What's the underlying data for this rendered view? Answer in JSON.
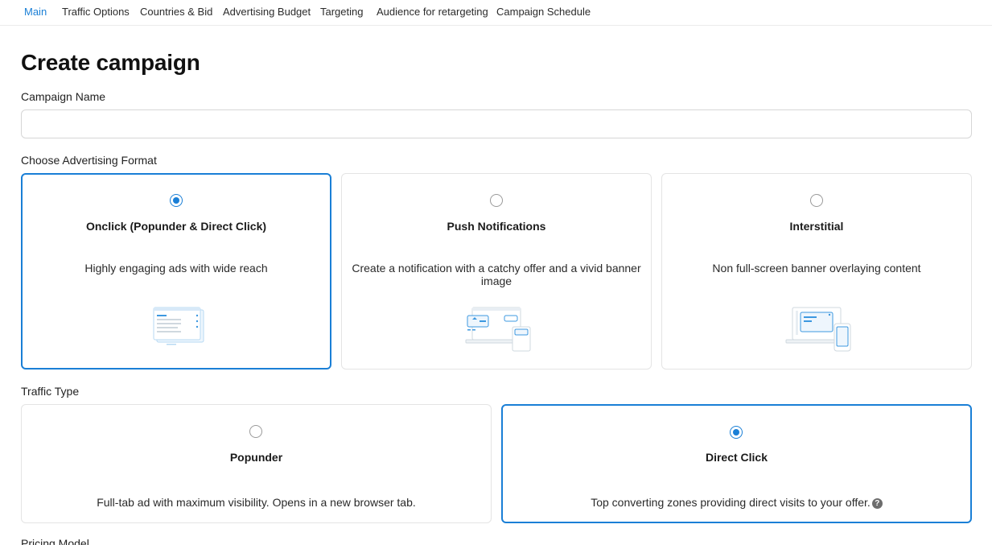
{
  "nav": {
    "tabs": [
      {
        "label": "Main",
        "active": true
      },
      {
        "label": "Traffic Options"
      },
      {
        "label": "Countries & Bid"
      },
      {
        "label": "Advertising Budget"
      },
      {
        "label": "Targeting"
      },
      {
        "label": "Audience for retargeting"
      },
      {
        "label": "Campaign Schedule"
      }
    ]
  },
  "page": {
    "title": "Create campaign"
  },
  "campaign_name": {
    "label": "Campaign Name",
    "value": "",
    "placeholder": ""
  },
  "format": {
    "label": "Choose Advertising Format",
    "options": [
      {
        "title": "Onclick (Popunder & Direct Click)",
        "description": "Highly engaging ads with wide reach",
        "selected": true,
        "icon": "onclick-illustration"
      },
      {
        "title": "Push Notifications",
        "description": "Create a notification with a catchy offer and a vivid banner image",
        "selected": false,
        "icon": "push-illustration"
      },
      {
        "title": "Interstitial",
        "description": "Non full-screen banner overlaying content",
        "selected": false,
        "icon": "interstitial-illustration"
      }
    ]
  },
  "traffic_type": {
    "label": "Traffic Type",
    "options": [
      {
        "title": "Popunder",
        "description": "Full-tab ad with maximum visibility. Opens in a new browser tab.",
        "selected": false
      },
      {
        "title": "Direct Click",
        "description": "Top converting zones providing direct visits to your offer.",
        "selected": true,
        "help": "?"
      }
    ]
  },
  "pricing": {
    "label": "Pricing Model"
  },
  "colors": {
    "accent": "#1a7fd6",
    "card_border": "#e4e4e4",
    "illustration": "#8fc3ee"
  }
}
